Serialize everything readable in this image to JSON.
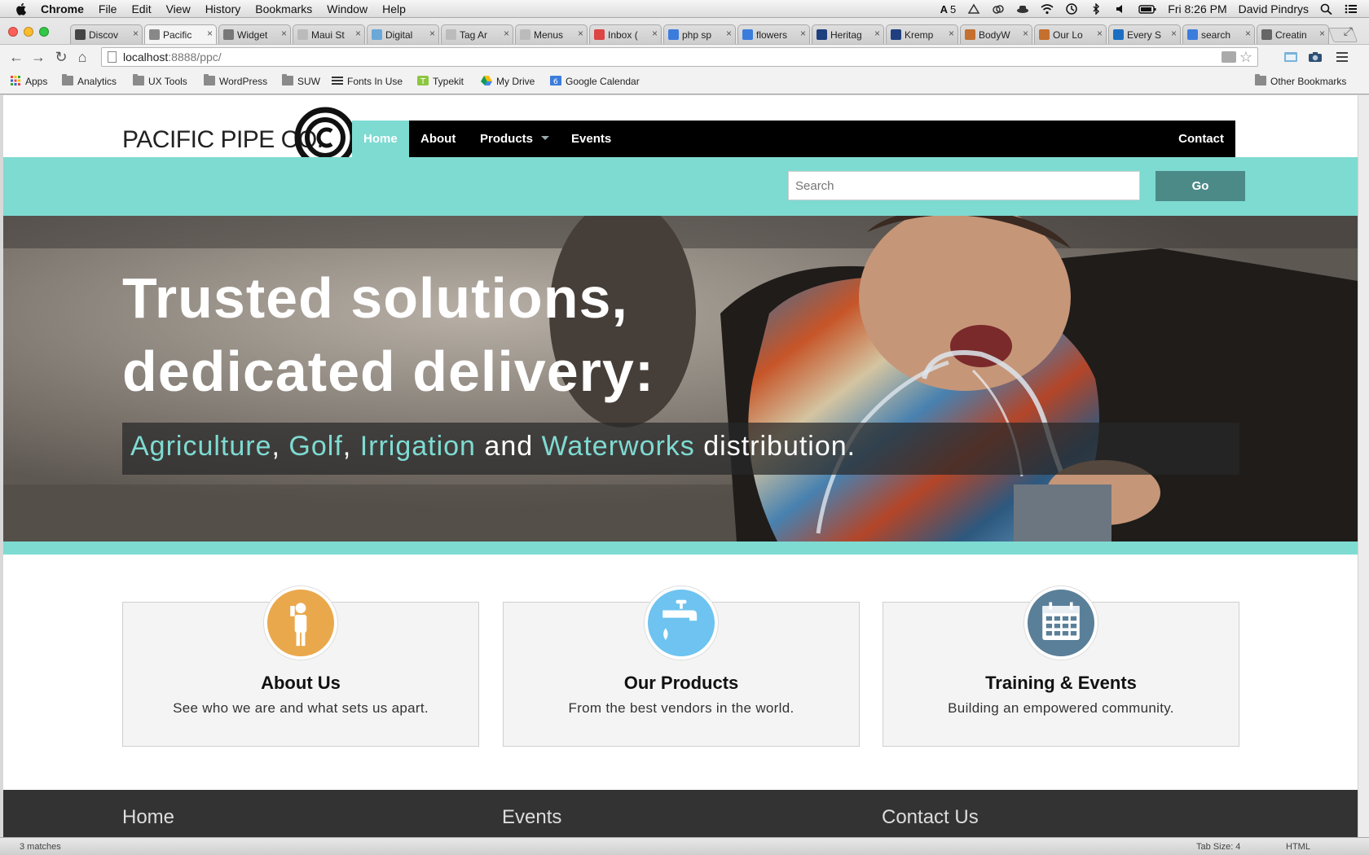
{
  "menubar": {
    "app": "Chrome",
    "items": [
      "File",
      "Edit",
      "View",
      "History",
      "Bookmarks",
      "Window",
      "Help"
    ],
    "status_battery_label": "5",
    "clock": "Fri 8:26 PM",
    "user": "David Pindrys"
  },
  "browser": {
    "tabs": [
      {
        "label": "Discov",
        "fav": "#444"
      },
      {
        "label": "Pacific",
        "fav": "#888"
      },
      {
        "label": "Widget",
        "fav": "#777"
      },
      {
        "label": "Maui St",
        "fav": "#bbb"
      },
      {
        "label": "Digital",
        "fav": "#6aa8d8"
      },
      {
        "label": "Tag Ar",
        "fav": "#bbb"
      },
      {
        "label": "Menus",
        "fav": "#bbb"
      },
      {
        "label": "Inbox (",
        "fav": "#d44"
      },
      {
        "label": "php sp",
        "fav": "#3b7ddd"
      },
      {
        "label": "flowers",
        "fav": "#3b7ddd"
      },
      {
        "label": "Heritag",
        "fav": "#1f3f7f"
      },
      {
        "label": "Kremp",
        "fav": "#1f3f7f"
      },
      {
        "label": "BodyW",
        "fav": "#c5702e"
      },
      {
        "label": "Our Lo",
        "fav": "#c5702e"
      },
      {
        "label": "Every S",
        "fav": "#1b6ec2"
      },
      {
        "label": "search",
        "fav": "#3b7ddd"
      },
      {
        "label": "Creatin",
        "fav": "#666"
      }
    ],
    "active_tab_index": 1,
    "url_host": "localhost",
    "url_rest": ":8888/ppc/",
    "bookmarks": [
      "Apps",
      "Analytics",
      "UX Tools",
      "WordPress",
      "SUW",
      "Fonts In Use",
      "Typekit",
      "My Drive",
      "Google Calendar"
    ],
    "other_bookmarks": "Other Bookmarks"
  },
  "site": {
    "logo_text": "PACIFIC PIPE CO.",
    "nav": {
      "home": "Home",
      "about": "About",
      "products": "Products",
      "events": "Events",
      "contact": "Contact"
    },
    "search": {
      "placeholder": "Search",
      "button": "Go"
    },
    "hero": {
      "line1": "Trusted solutions,",
      "line2": "dedicated delivery:",
      "sub": {
        "agriculture": "Agriculture",
        "comma1": ", ",
        "golf": "Golf",
        "comma2": ", ",
        "irrigation": "Irrigation",
        "and": " and ",
        "waterworks": "Waterworks",
        "tail": " distribution."
      }
    },
    "cards": [
      {
        "title": "About Us",
        "desc": "See who we are and what sets us apart.",
        "color": "#eaa84c",
        "icon": "person-icon"
      },
      {
        "title": "Our Products",
        "desc": "From the best vendors in the world.",
        "color": "#6ec3f0",
        "icon": "faucet-icon"
      },
      {
        "title": "Training & Events",
        "desc": "Building an empowered community.",
        "color": "#5a7f99",
        "icon": "calendar-icon"
      }
    ],
    "footer": {
      "col1": "Home",
      "col2": "Events",
      "col3": "Contact Us"
    }
  },
  "editor_status": {
    "matches": "3 matches",
    "tab_size": "Tab Size: 4",
    "syntax": "HTML"
  },
  "colors": {
    "teal": "#7edbd2",
    "go_button": "#4b8a87",
    "nav_bg": "#000000",
    "footer_bg": "#333333"
  }
}
